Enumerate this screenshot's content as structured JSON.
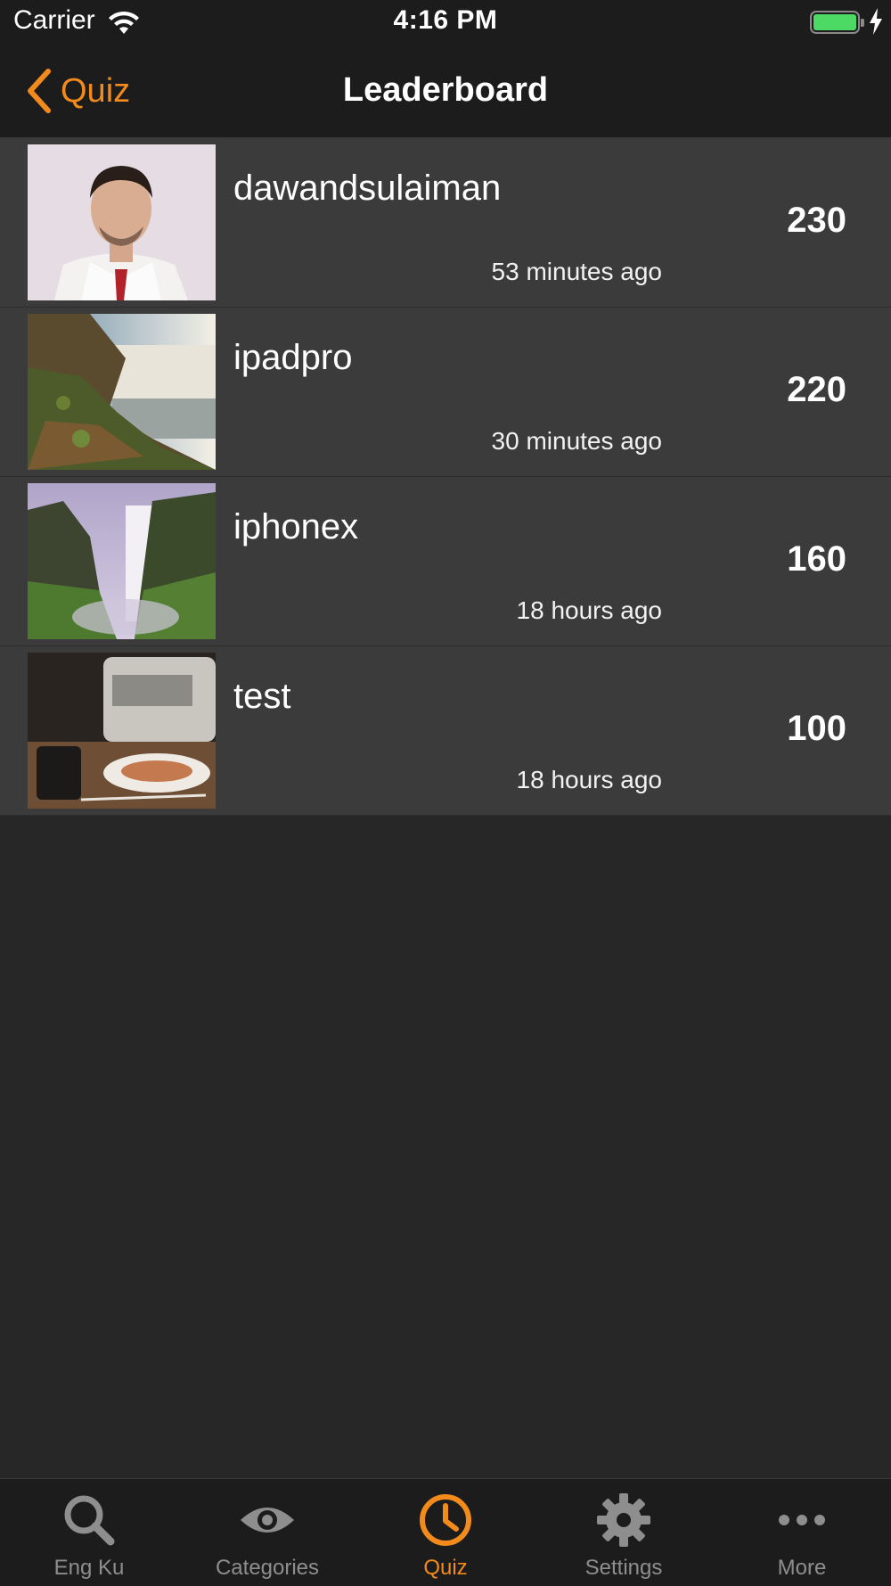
{
  "status_bar": {
    "carrier": "Carrier",
    "time": "4:16 PM",
    "battery_color": "#4cd964"
  },
  "nav": {
    "back_label": "Quiz",
    "title": "Leaderboard",
    "accent": "#f28a1c"
  },
  "leaderboard": [
    {
      "username": "dawandsulaiman",
      "score": "230",
      "time": "53 minutes ago",
      "avatar": "person-photo"
    },
    {
      "username": "ipadpro",
      "score": "220",
      "time": "30 minutes ago",
      "avatar": "waterfall-photo"
    },
    {
      "username": "iphonex",
      "score": "160",
      "time": "18 hours ago",
      "avatar": "waterfall-photo-2"
    },
    {
      "username": "test",
      "score": "100",
      "time": "18 hours ago",
      "avatar": "train-window-photo"
    }
  ],
  "tabs": [
    {
      "label": "Eng Ku",
      "icon": "search-icon"
    },
    {
      "label": "Categories",
      "icon": "eye-icon"
    },
    {
      "label": "Quiz",
      "icon": "clock-icon",
      "active": true
    },
    {
      "label": "Settings",
      "icon": "gear-icon"
    },
    {
      "label": "More",
      "icon": "more-icon"
    }
  ]
}
